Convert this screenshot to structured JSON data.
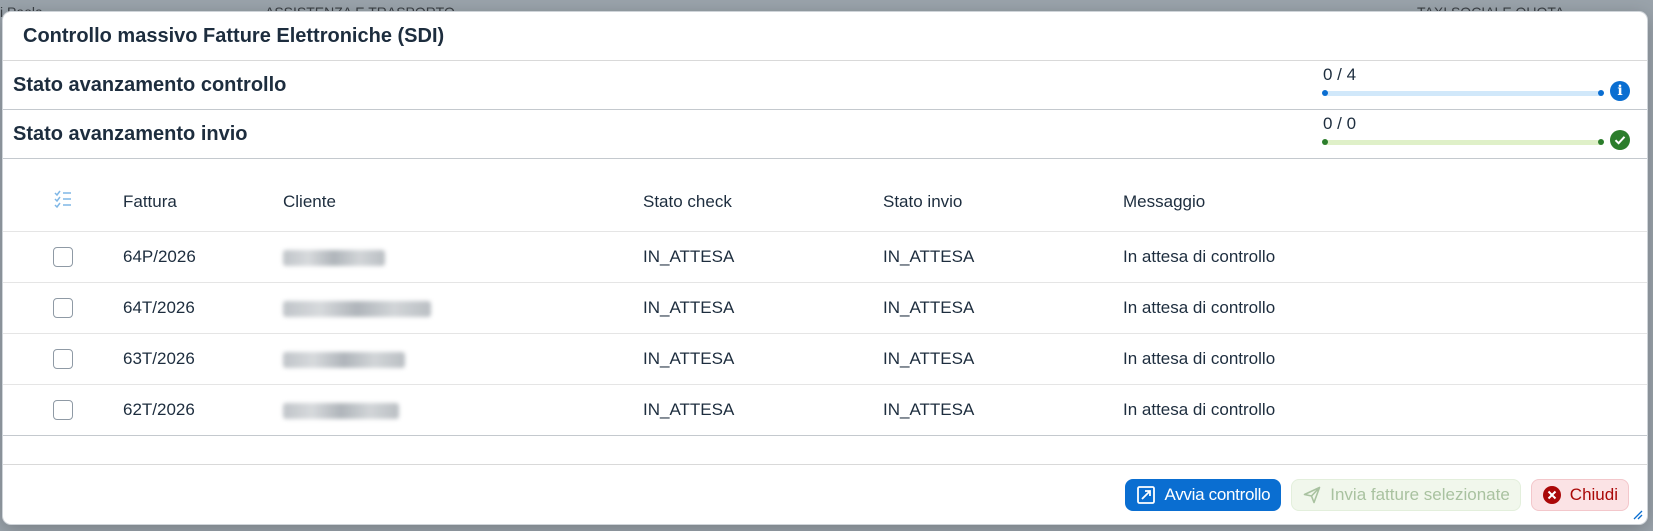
{
  "background": {
    "left_text": "i Paola",
    "center_text": "ASSISTENZA E TRASPORTO",
    "right_text": "TAXI SOCIALE QUOTA"
  },
  "dialog": {
    "title": "Controllo massivo Fatture Elettroniche (SDI)"
  },
  "progress": {
    "check": {
      "label": "Stato avanzamento controllo",
      "count": "0 / 4",
      "value": 0,
      "icon": "info-icon",
      "color": "#0a6ed1",
      "track_color": "#d1e8fa"
    },
    "send": {
      "label": "Stato avanzamento invio",
      "count": "0 / 0",
      "value": 0,
      "icon": "check-circle-icon",
      "color": "#2b7d2b",
      "track_color": "#dff0c8"
    }
  },
  "table": {
    "columns": {
      "fattura": "Fattura",
      "cliente": "Cliente",
      "stato_check": "Stato check",
      "stato_invio": "Stato invio",
      "messaggio": "Messaggio"
    },
    "rows": [
      {
        "fattura": "64P/2026",
        "stato_check": "IN_ATTESA",
        "stato_invio": "IN_ATTESA",
        "messaggio": "In attesa di controllo"
      },
      {
        "fattura": "64T/2026",
        "stato_check": "IN_ATTESA",
        "stato_invio": "IN_ATTESA",
        "messaggio": "In attesa di controllo"
      },
      {
        "fattura": "63T/2026",
        "stato_check": "IN_ATTESA",
        "stato_invio": "IN_ATTESA",
        "messaggio": "In attesa di controllo"
      },
      {
        "fattura": "62T/2026",
        "stato_check": "IN_ATTESA",
        "stato_invio": "IN_ATTESA",
        "messaggio": "In attesa di controllo"
      }
    ]
  },
  "footer": {
    "start_check": "Avvia controllo",
    "send_selected": "Invia fatture selezionate",
    "close": "Chiudi"
  }
}
